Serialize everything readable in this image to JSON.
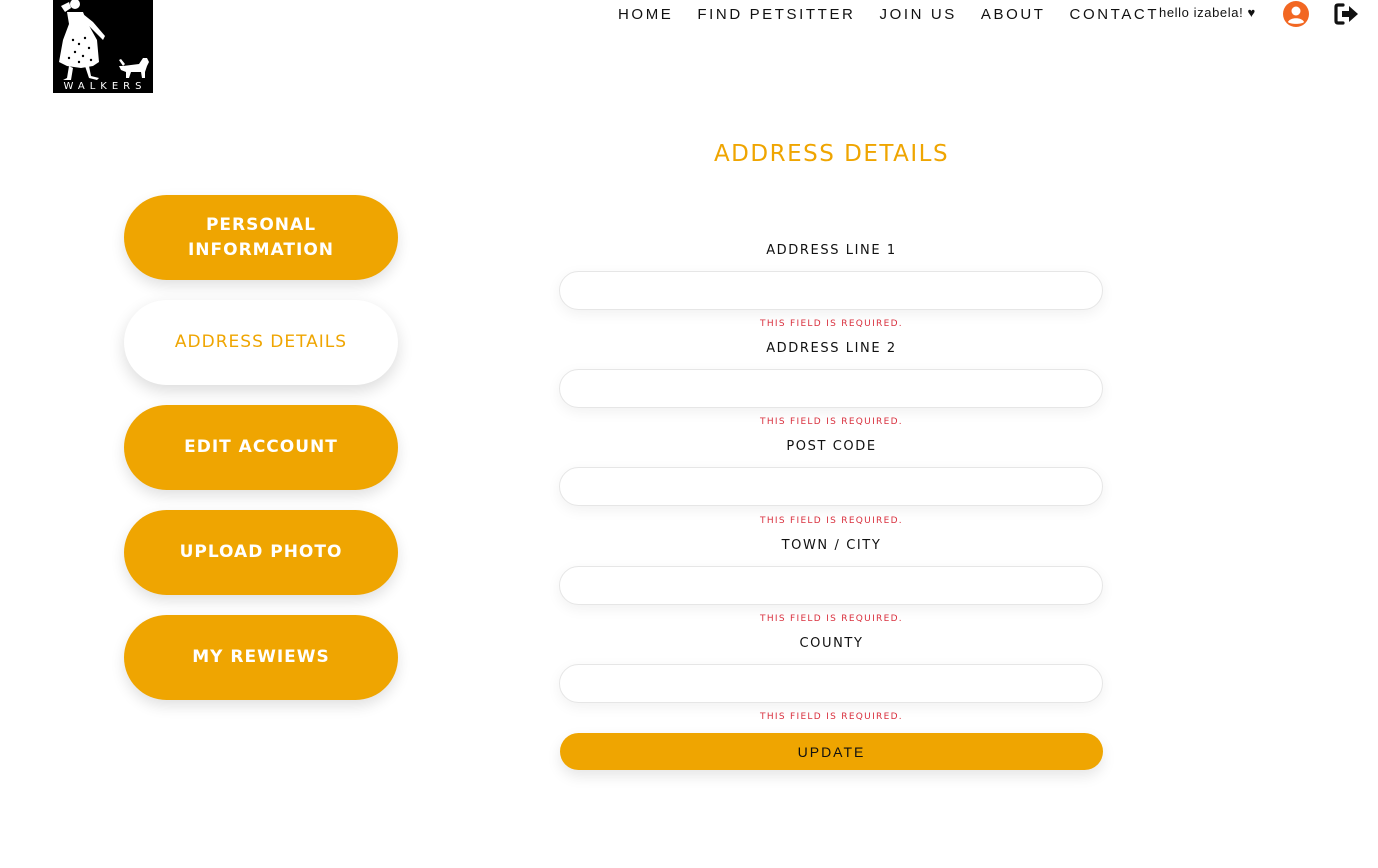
{
  "header": {
    "logo_text": "WALKERS",
    "nav": [
      {
        "label": "HOME"
      },
      {
        "label": "FIND PETSITTER"
      },
      {
        "label": "JOIN US"
      },
      {
        "label": "ABOUT"
      },
      {
        "label": "CONTACT"
      }
    ],
    "greeting": "hello izabela! ♥",
    "user_icon": "user-circle-icon",
    "logout_icon": "sign-out-icon"
  },
  "sidebar": {
    "items": [
      {
        "label": "PERSONAL INFORMATION",
        "active": false
      },
      {
        "label": "ADDRESS DETAILS",
        "active": true
      },
      {
        "label": "EDIT ACCOUNT",
        "active": false
      },
      {
        "label": "UPLOAD PHOTO",
        "active": false
      },
      {
        "label": "MY REWIEWS",
        "active": false
      }
    ]
  },
  "form": {
    "title": "ADDRESS DETAILS",
    "fields": [
      {
        "label": "ADDRESS LINE 1",
        "value": "",
        "error": "THIS FIELD IS REQUIRED."
      },
      {
        "label": "ADDRESS LINE 2",
        "value": "",
        "error": "THIS FIELD IS REQUIRED."
      },
      {
        "label": "POST CODE",
        "value": "",
        "error": "THIS FIELD IS REQUIRED."
      },
      {
        "label": "TOWN / CITY",
        "value": "",
        "error": "THIS FIELD IS REQUIRED."
      },
      {
        "label": "COUNTY",
        "value": "",
        "error": "THIS FIELD IS REQUIRED."
      }
    ],
    "submit_label": "UPDATE"
  },
  "colors": {
    "accent": "#efa501",
    "error": "#d9303e",
    "user_icon": "#f26722"
  }
}
